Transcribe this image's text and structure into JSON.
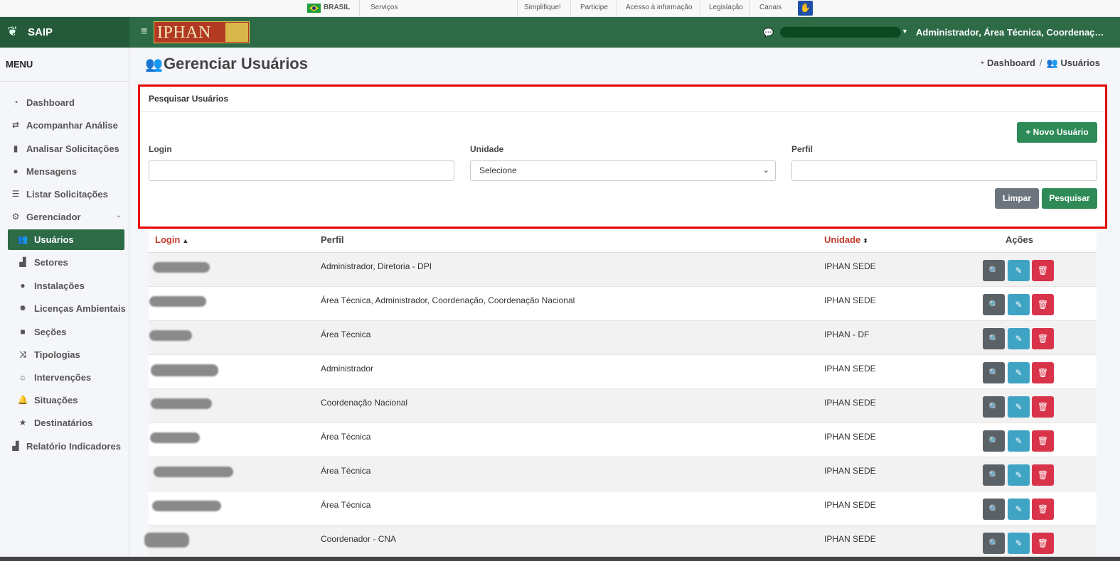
{
  "govbar": {
    "country": "BRASIL",
    "services": "Serviços",
    "links": [
      "Simplifique!",
      "Participe",
      "Acesso à informação",
      "Legislação",
      "Canais"
    ]
  },
  "header": {
    "brand": "SAIP",
    "logo_text": "IPHAN",
    "user_role": "Administrador, Área Técnica, Coordenação..."
  },
  "sidebar": {
    "title": "MENU",
    "items": [
      {
        "label": "Dashboard",
        "icon": "tachometer-icon"
      },
      {
        "label": "Acompanhar Análise",
        "icon": "exchange-icon"
      },
      {
        "label": "Analisar Solicitações",
        "icon": "book-icon"
      },
      {
        "label": "Mensagens",
        "icon": "comments-icon"
      },
      {
        "label": "Listar Solicitações",
        "icon": "list-icon"
      },
      {
        "label": "Gerenciador",
        "icon": "cogs-icon"
      },
      {
        "label": "Usuários",
        "icon": "users-icon"
      },
      {
        "label": "Setores",
        "icon": "area-chart-icon"
      },
      {
        "label": "Instalações",
        "icon": "circle-icon"
      },
      {
        "label": "Licenças Ambientais",
        "icon": "certificate-icon"
      },
      {
        "label": "Seções",
        "icon": "square-icon"
      },
      {
        "label": "Tipologias",
        "icon": "random-icon"
      },
      {
        "label": "Intervenções",
        "icon": "sun-icon"
      },
      {
        "label": "Situações",
        "icon": "bell-icon"
      },
      {
        "label": "Destinatários",
        "icon": "star-icon"
      },
      {
        "label": "Relatório Indicadores",
        "icon": "area-chart-icon"
      }
    ]
  },
  "page": {
    "title": "Gerenciar Usuários",
    "breadcrumb": {
      "home": "Dashboard",
      "current": "Usuários"
    }
  },
  "search": {
    "card_title": "Pesquisar Usuários",
    "new_user_label": "+ Novo Usuário",
    "login_label": "Login",
    "login_value": "",
    "unit_label": "Unidade",
    "unit_selected": "Selecione",
    "profile_label": "Perfil",
    "profile_value": "",
    "clear_label": "Limpar",
    "search_label": "Pesquisar"
  },
  "table": {
    "headers": {
      "login": "Login",
      "perfil": "Perfil",
      "unidade": "Unidade",
      "acoes": "Ações"
    },
    "rows": [
      {
        "perfil": "Administrador, Diretoria - DPI",
        "unidade": "IPHAN SEDE"
      },
      {
        "perfil": "Área Técnica, Administrador, Coordenação, Coordenação Nacional",
        "unidade": "IPHAN SEDE"
      },
      {
        "perfil": "Área Técnica",
        "unidade": "IPHAN - DF"
      },
      {
        "perfil": "Administrador",
        "unidade": "IPHAN SEDE"
      },
      {
        "perfil": "Coordenação Nacional",
        "unidade": "IPHAN SEDE"
      },
      {
        "perfil": "Área Técnica",
        "unidade": "IPHAN SEDE"
      },
      {
        "perfil": "Área Técnica",
        "unidade": "IPHAN SEDE"
      },
      {
        "perfil": "Área Técnica",
        "unidade": "IPHAN SEDE"
      },
      {
        "perfil": "Coordenador - CNA",
        "unidade": "IPHAN SEDE"
      }
    ]
  },
  "colors": {
    "header": "#2c6b46",
    "accent_green": "#2e8b57",
    "danger": "#d9334a",
    "info": "#3fa3c4",
    "highlight_border": "#e60000"
  }
}
